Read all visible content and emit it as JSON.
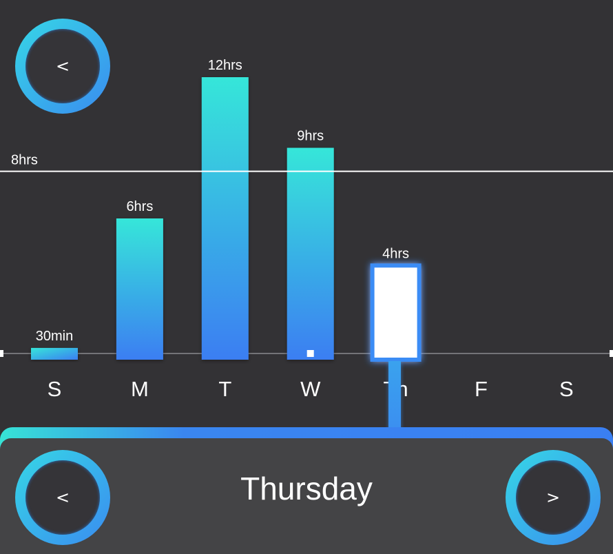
{
  "nav": {
    "back_glyph": "<",
    "prev_glyph": "<",
    "next_glyph": ">"
  },
  "selected_day": {
    "title": "Thursday",
    "index": 4
  },
  "colors": {
    "background": "#333235",
    "panel": "#444446",
    "gradient_start": "#36e6d9",
    "gradient_end": "#3b7ef2",
    "selected_bar": "#ffffff",
    "target_line": "#ffffff"
  },
  "chart_data": {
    "type": "bar",
    "categories": [
      "S",
      "M",
      "T",
      "W",
      "Th",
      "F",
      "S"
    ],
    "values": [
      0.5,
      6,
      12,
      9,
      4,
      null,
      null
    ],
    "value_labels": [
      "30min",
      "6hrs",
      "12hrs",
      "9hrs",
      "4hrs",
      "",
      ""
    ],
    "unit": "hrs",
    "ylim": [
      0,
      13.2
    ],
    "target": {
      "value": 8,
      "label": "8hrs"
    },
    "selected_index": 4,
    "grid": false
  }
}
